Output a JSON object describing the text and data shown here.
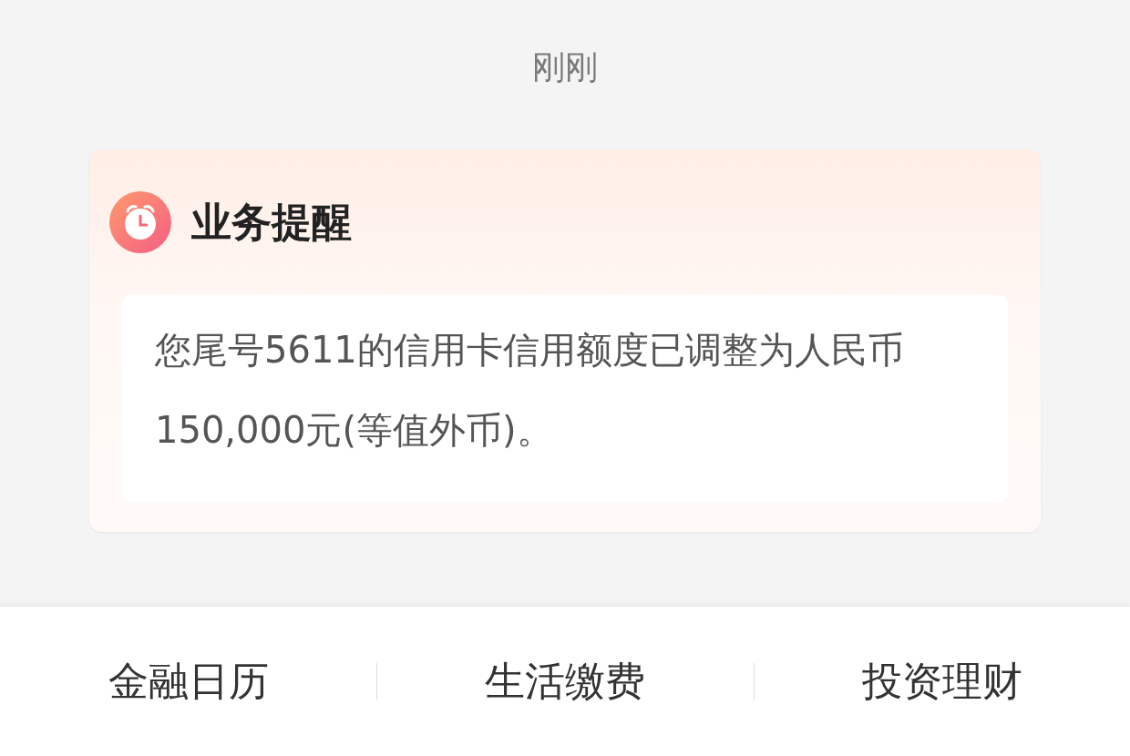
{
  "timestamp": "刚刚",
  "card": {
    "title": "业务提醒",
    "message": "您尾号5611的信用卡信用额度已调整为人民币150,000元(等值外币)。"
  },
  "bottom_menu": [
    "金融日历",
    "生活缴费",
    "投资理财"
  ]
}
